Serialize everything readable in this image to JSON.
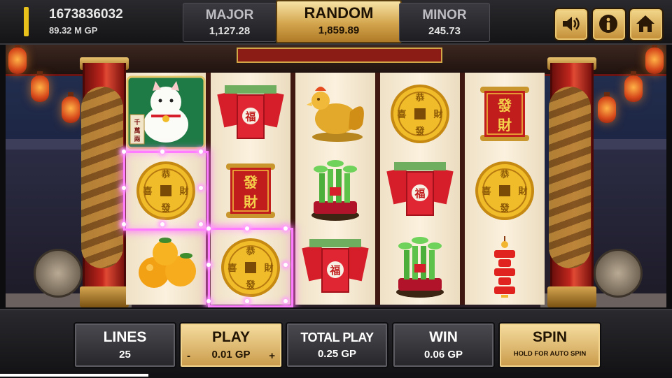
{
  "player": {
    "id": "1673836032",
    "balance": "89.32 M GP"
  },
  "jackpots": {
    "major": {
      "label": "MAJOR",
      "value": "1,127.28"
    },
    "random": {
      "label": "RANDOM",
      "value": "1,859.89"
    },
    "minor": {
      "label": "MINOR",
      "value": "245.73"
    }
  },
  "top_buttons": [
    "speaker-icon",
    "info-icon",
    "home-icon"
  ],
  "reels": [
    [
      "lucky-cat",
      "gold-coin",
      "mandarin-oranges"
    ],
    [
      "red-envelopes",
      "fortune-scroll",
      "gold-coin"
    ],
    [
      "golden-rooster",
      "lucky-bamboo",
      "red-envelopes"
    ],
    [
      "gold-coin",
      "red-envelopes",
      "lucky-bamboo"
    ],
    [
      "fortune-scroll",
      "gold-coin",
      "firecrackers"
    ]
  ],
  "symbol_text": {
    "coin_chars": [
      "恭",
      "喜",
      "財",
      "發"
    ],
    "scroll_chars": [
      "發",
      "財"
    ],
    "envelope_char": "福",
    "cat_sign": "千萬兩"
  },
  "winning_cells": [
    [
      0,
      1
    ],
    [
      1,
      2
    ]
  ],
  "colors": {
    "win_highlight": "#ff7bff",
    "button_gold": "#e3bd6d",
    "reel_bg": "#f5e9d2"
  },
  "controls": {
    "lines": {
      "label": "LINES",
      "value": "25"
    },
    "play": {
      "label": "PLAY",
      "value": "0.01 GP",
      "minus": "-",
      "plus": "+"
    },
    "total_play": {
      "label": "TOTAL PLAY",
      "value": "0.25 GP"
    },
    "win": {
      "label": "WIN",
      "value": "0.06 GP"
    },
    "spin": {
      "label": "SPIN",
      "sub": "HOLD FOR AUTO SPIN"
    }
  }
}
